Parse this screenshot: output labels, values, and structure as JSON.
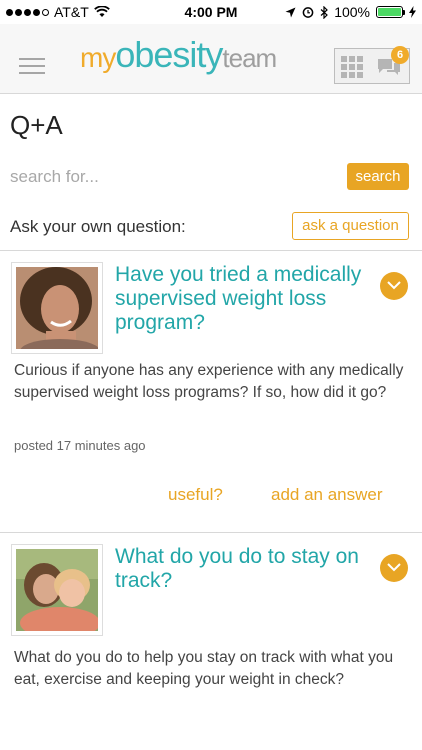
{
  "status_bar": {
    "carrier": "AT&T",
    "time": "4:00 PM",
    "battery": "100%"
  },
  "header": {
    "logo": {
      "my": "my",
      "obesity": "obesity",
      "team": "team"
    },
    "notification_count": "6"
  },
  "page": {
    "title": "Q+A"
  },
  "search": {
    "placeholder": "search for...",
    "button_label": "search"
  },
  "ask": {
    "label": "Ask your own question:",
    "button_label": "ask a question"
  },
  "questions": [
    {
      "title": "Have you tried a medically supervised weight loss program?",
      "body": "Curious if anyone has any experience with any medically supervised weight loss programs? If so, how did it go?",
      "posted": "posted 17 minutes ago",
      "useful_label": "useful?",
      "answer_label": "add an answer"
    },
    {
      "title": "What do you do to stay on track?",
      "body": "What do you do to help you stay on track with what you eat, exercise and keeping your weight in check?"
    }
  ],
  "colors": {
    "accent_orange": "#e8a524",
    "teal": "#22a6a8"
  }
}
